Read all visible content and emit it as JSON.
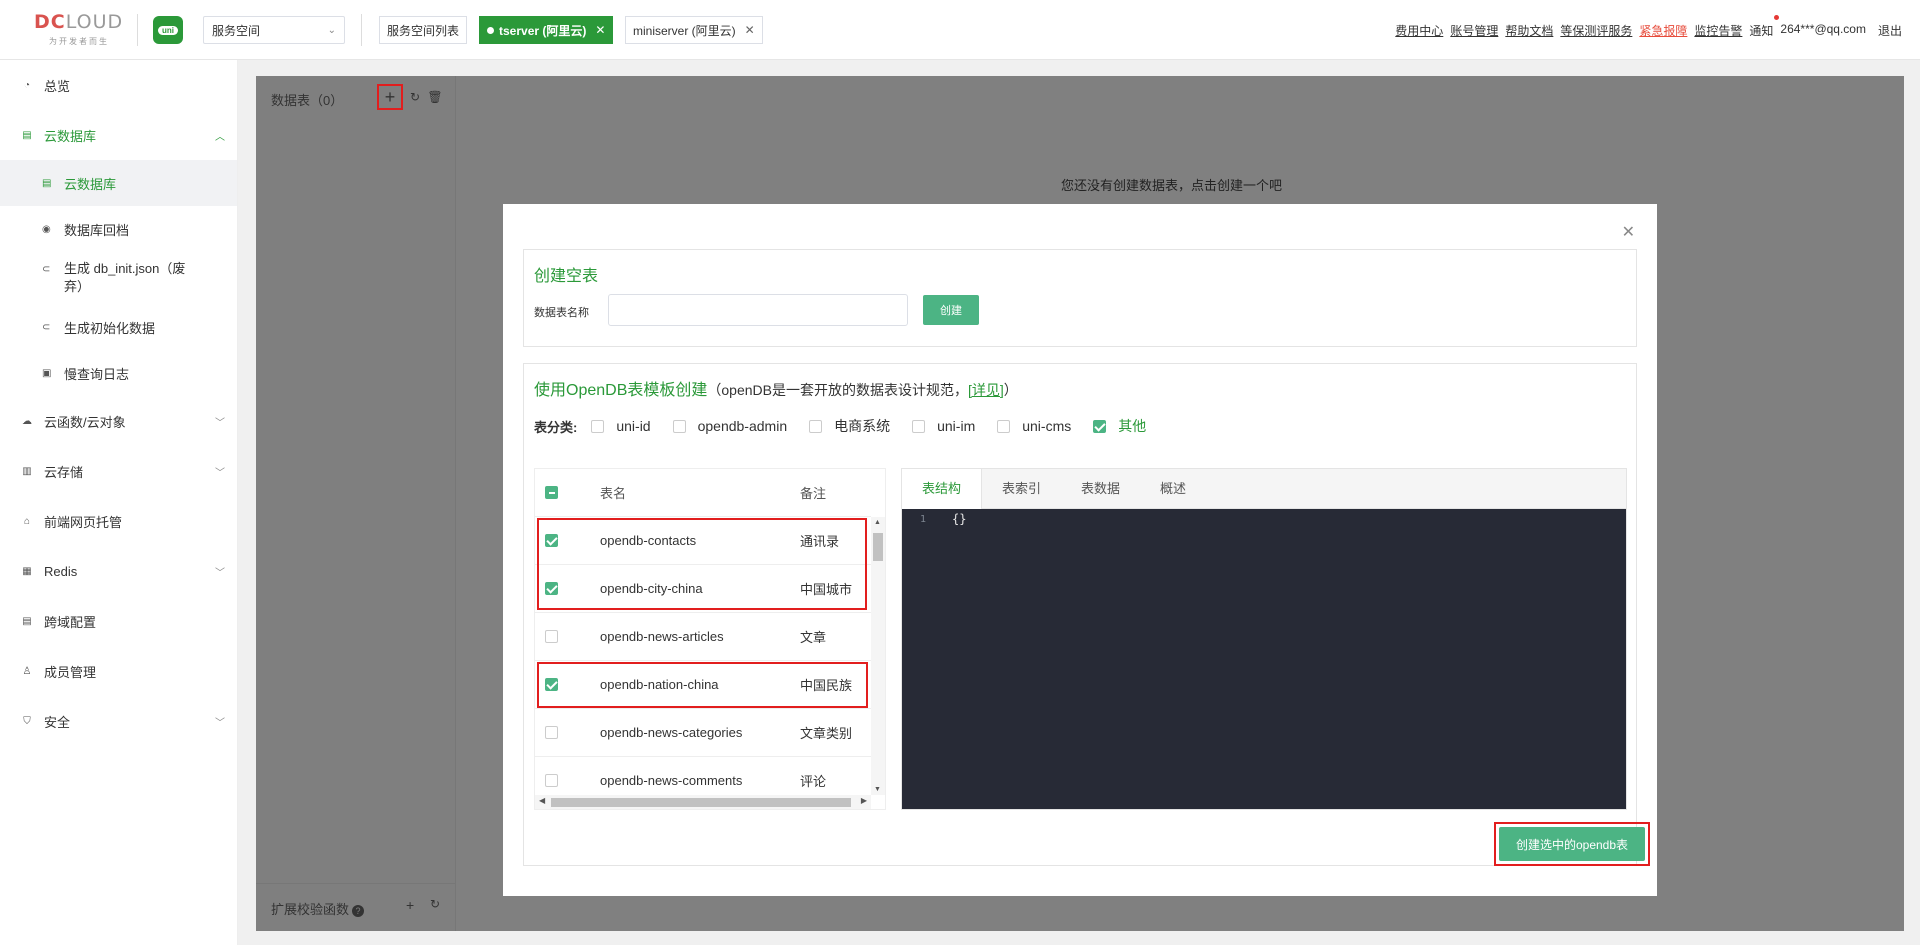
{
  "header": {
    "logo_text_a": "DC",
    "logo_text_b": "LOUD",
    "logo_sub": "为开发者而生",
    "uni_logo": "uni",
    "space_select": "服务空间",
    "space_list_btn": "服务空间列表",
    "active_space": "tserver (阿里云)",
    "other_space": "miniserver (阿里云)",
    "links": [
      "费用中心",
      "账号管理",
      "帮助文档",
      "等保测评服务"
    ],
    "red_link": "紧急报障",
    "monitor_link": "监控告警",
    "notify": "通知",
    "email": "264***@qq.com",
    "logout": "退出"
  },
  "sidebar": {
    "overview": "总览",
    "cloud_db": "云数据库",
    "sub": {
      "cloud_db": "云数据库",
      "backup": "数据库回档",
      "db_init": "生成 db_init.json（废弃）",
      "init_data": "生成初始化数据",
      "slow_log": "慢查询日志"
    },
    "functions": "云函数/云对象",
    "storage": "云存储",
    "hosting": "前端网页托管",
    "redis": "Redis",
    "cors": "跨域配置",
    "members": "成员管理",
    "security": "安全"
  },
  "left_panel": {
    "title": "数据表（0）",
    "footer": "扩展校验函数"
  },
  "empty_msg": "您还没有创建数据表，点击创建一个吧",
  "modal": {
    "create_empty_title": "创建空表",
    "table_name_label": "数据表名称",
    "create_btn": "创建",
    "opendb_title": "使用OpenDB表模板创建",
    "opendb_desc_a": "（openDB是一套开放的数据表设计规范，",
    "opendb_link": "[详见]",
    "opendb_desc_b": "）",
    "category_label": "表分类:",
    "categories": [
      "uni-id",
      "opendb-admin",
      "电商系统",
      "uni-im",
      "uni-cms",
      "其他"
    ],
    "table_header": {
      "name": "表名",
      "note": "备注"
    },
    "rows": [
      {
        "name": "opendb-contacts",
        "note": "通讯录"
      },
      {
        "name": "opendb-city-china",
        "note": "中国城市"
      },
      {
        "name": "opendb-news-articles",
        "note": "文章"
      },
      {
        "name": "opendb-nation-china",
        "note": "中国民族"
      },
      {
        "name": "opendb-news-categories",
        "note": "文章类别"
      },
      {
        "name": "opendb-news-comments",
        "note": "评论"
      }
    ],
    "tabs": [
      "表结构",
      "表索引",
      "表数据",
      "概述"
    ],
    "editor_line": "1",
    "editor_code": "{}",
    "create_selected_btn": "创建选中的opendb表"
  }
}
